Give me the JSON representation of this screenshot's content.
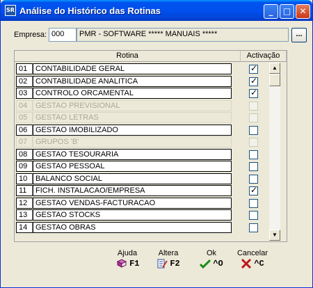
{
  "window": {
    "title": "Análise do Histórico das Rotinas",
    "app_icon_text": "SR"
  },
  "empresa": {
    "label": "Empresa:",
    "code": "000",
    "name": "PMR - SOFTWARE ***** MANUAIS *****",
    "lookup_label": "..."
  },
  "grid": {
    "headers": {
      "rotina": "Rotina",
      "activacao": "Activação"
    },
    "rows": [
      {
        "num": "01",
        "name": "CONTABILIDADE GERAL",
        "enabled": true,
        "checked": true
      },
      {
        "num": "02",
        "name": "CONTABILIDADE ANALITICA",
        "enabled": true,
        "checked": true
      },
      {
        "num": "03",
        "name": "CONTROLO ORCAMENTAL",
        "enabled": true,
        "checked": true
      },
      {
        "num": "04",
        "name": "GESTAO PREVISIONAL",
        "enabled": false,
        "checked": false
      },
      {
        "num": "05",
        "name": "GESTAO LETRAS",
        "enabled": false,
        "checked": false
      },
      {
        "num": "06",
        "name": "GESTAO IMOBILIZADO",
        "enabled": true,
        "checked": false
      },
      {
        "num": "07",
        "name": "GRUPOS 'B'",
        "enabled": false,
        "checked": false
      },
      {
        "num": "08",
        "name": "GESTAO TESOURARIA",
        "enabled": true,
        "checked": false
      },
      {
        "num": "09",
        "name": "GESTAO PESSOAL",
        "enabled": true,
        "checked": false
      },
      {
        "num": "10",
        "name": "BALANCO SOCIAL",
        "enabled": true,
        "checked": false
      },
      {
        "num": "11",
        "name": "FICH. INSTALACAO/EMPRESA",
        "enabled": true,
        "checked": true
      },
      {
        "num": "12",
        "name": "GESTAO VENDAS-FACTURACAO",
        "enabled": true,
        "checked": false
      },
      {
        "num": "13",
        "name": "GESTAO STOCKS",
        "enabled": true,
        "checked": false
      },
      {
        "num": "14",
        "name": "GESTAO OBRAS",
        "enabled": true,
        "checked": false
      }
    ]
  },
  "function_keys": [
    {
      "id": "ajuda",
      "label": "Ajuda",
      "key": "F1",
      "icon": "book-icon",
      "color": "#b03090"
    },
    {
      "id": "altera",
      "label": "Altera",
      "key": "F2",
      "icon": "edit-document-icon",
      "color": "#2a4a9a"
    },
    {
      "id": "ok",
      "label": "Ok",
      "key": "^O",
      "icon": "checkmark-icon",
      "color": "#1a8a1a"
    },
    {
      "id": "cancelar",
      "label": "Cancelar",
      "key": "^C",
      "icon": "x-cross-icon",
      "color": "#c01818"
    }
  ]
}
